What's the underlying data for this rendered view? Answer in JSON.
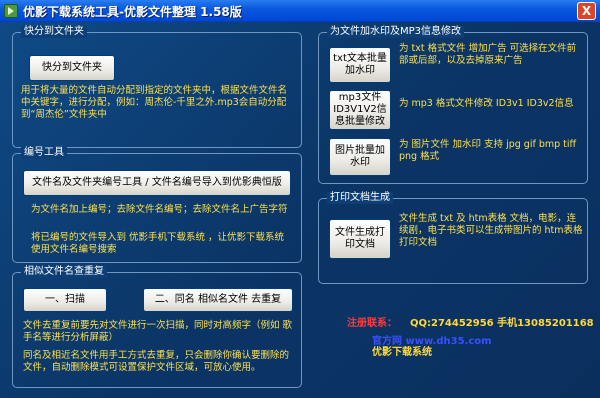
{
  "window": {
    "title": "优影下载系统工具-优影文件整理 1.58版",
    "close_symbol": "X"
  },
  "group_quick": {
    "title": "快分到文件夹",
    "button": "快分到文件夹",
    "desc": "用于将大量的文件自动分配到指定的文件夹中，根据文件文件名中关键字，进行分配，例如：周杰伦-千里之外.mp3会自动分配到“周杰伦”文件夹中"
  },
  "group_number": {
    "title": "编号工具",
    "button": "文件名及文件夹编号工具 / 文件名编号导入到优影典恒版",
    "desc1": "为文件名加上编号；去除文件名编号；去除文件名上广告字符",
    "desc2": "将已编号的文件导入到 优影手机下载系统 ，让优影下载系统使用文件名编号搜索"
  },
  "group_dup": {
    "title": "相似文件名查重复",
    "button_scan": "一、扫描",
    "button_dup": "二、同名 相似名文件 去重复",
    "desc1": "文件去重复前要先对文件进行一次扫描，同时对高频字（例如 歌手名等进行分析屏蔽）",
    "desc2": "同名及相近名文件用手工方式去重复，只会删除你确认要删除的文件，自动删除模式可设置保护文件区域，可放心使用。"
  },
  "group_watermark": {
    "title": "为文件加水印及MP3信息修改",
    "btn_txt": "txt文本批量加水印",
    "desc_txt": "为 txt 格式文件 增加广告 可选择在文件前部或后部，以及去掉原来广告",
    "btn_mp3": "mp3文件ID3V1V2信息批量修改",
    "desc_mp3": "为 mp3 格式文件修改 ID3v1 ID3v2信息",
    "btn_img": "图片批量加水印",
    "desc_img": "为 图片文件 加水印 支持 jpg gif bmp tiff png 格式"
  },
  "group_print": {
    "title": "打印文档生成",
    "button": "文件生成打印文档",
    "desc": "文件生成 txt 及 htm表格 文档，电影，连续剧，电子书类可以生成带图片的 htm表格 打印文档"
  },
  "contact": {
    "label": "注册联系：",
    "qq": "QQ:274452956 手机13085201168",
    "site": "官方网 www.dh35.com",
    "brand": "优影下载系统"
  }
}
